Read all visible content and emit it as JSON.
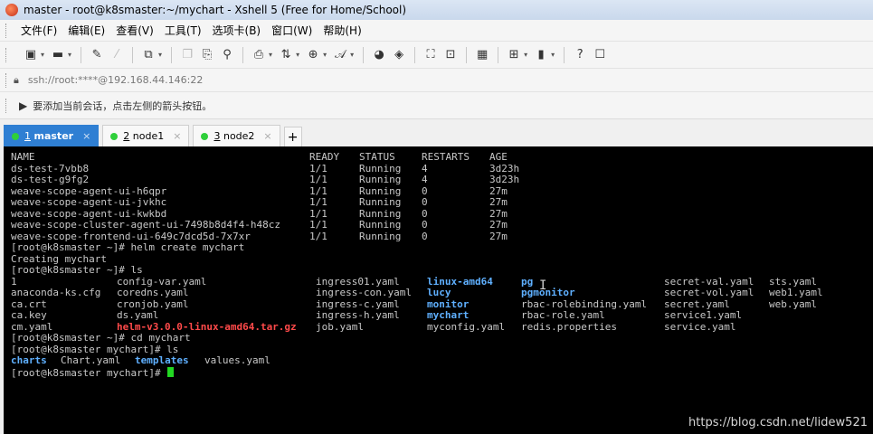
{
  "window": {
    "title": "master - root@k8smaster:~/mychart - Xshell 5 (Free for Home/School)"
  },
  "menu": [
    "文件(F)",
    "编辑(E)",
    "查看(V)",
    "工具(T)",
    "选项卡(B)",
    "窗口(W)",
    "帮助(H)"
  ],
  "toolbar": {
    "icons": [
      "new-session-icon",
      "open-folder-icon",
      "connect-icon",
      "disconnect-icon",
      "new-window-icon",
      "copy-icon",
      "paste-icon",
      "find-icon",
      "print-icon",
      "transfer-icon",
      "globe-icon",
      "font-icon",
      "color-icon",
      "script-icon",
      "fullscreen-icon",
      "lock-icon",
      "keyboard-icon",
      "add-icon",
      "layout-icon",
      "help-icon",
      "chat-icon"
    ]
  },
  "address": {
    "text": "ssh://root:****@192.168.44.146:22"
  },
  "hint": {
    "text": "要添加当前会话，点击左侧的箭头按钮。"
  },
  "tabs": [
    {
      "num": "1",
      "label": "master",
      "active": true
    },
    {
      "num": "2",
      "label": "node1",
      "active": false
    },
    {
      "num": "3",
      "label": "node2",
      "active": false
    }
  ],
  "terminal": {
    "pods": {
      "headers": [
        "NAME",
        "READY",
        "STATUS",
        "RESTARTS",
        "AGE"
      ],
      "rows": [
        [
          "ds-test-7vbb8",
          "1/1",
          "Running",
          "4",
          "3d23h"
        ],
        [
          "ds-test-g9fg2",
          "1/1",
          "Running",
          "4",
          "3d23h"
        ],
        [
          "weave-scope-agent-ui-h6qpr",
          "1/1",
          "Running",
          "0",
          "27m"
        ],
        [
          "weave-scope-agent-ui-jvkhc",
          "1/1",
          "Running",
          "0",
          "27m"
        ],
        [
          "weave-scope-agent-ui-kwkbd",
          "1/1",
          "Running",
          "0",
          "27m"
        ],
        [
          "weave-scope-cluster-agent-ui-7498b8d4f4-h48cz",
          "1/1",
          "Running",
          "0",
          "27m"
        ],
        [
          "weave-scope-frontend-ui-649c7dcd5d-7x7xr",
          "1/1",
          "Running",
          "0",
          "27m"
        ]
      ]
    },
    "lines": {
      "cmd1": "[root@k8smaster ~]# helm create mychart",
      "out1": "Creating mychart",
      "cmd2": "[root@k8smaster ~]# ls",
      "cmd3": "[root@k8smaster ~]# cd mychart",
      "cmd4": "[root@k8smaster mychart]# ls",
      "prompt": "[root@k8smaster mychart]# "
    },
    "ls_root": [
      [
        {
          "t": "1"
        },
        {
          "t": "config-var.yaml"
        },
        {
          "t": "ingress01.yaml"
        },
        {
          "t": "linux-amd64",
          "c": "blue"
        },
        {
          "t": "pg",
          "c": "blue"
        },
        {
          "t": "secret-val.yaml"
        },
        {
          "t": "sts.yaml"
        }
      ],
      [
        {
          "t": "anaconda-ks.cfg"
        },
        {
          "t": "coredns.yaml"
        },
        {
          "t": "ingress-con.yaml"
        },
        {
          "t": "lucy",
          "c": "blue"
        },
        {
          "t": "pgmonitor",
          "c": "blue"
        },
        {
          "t": "secret-vol.yaml"
        },
        {
          "t": "web1.yaml"
        }
      ],
      [
        {
          "t": "ca.crt"
        },
        {
          "t": "cronjob.yaml"
        },
        {
          "t": "ingress-c.yaml"
        },
        {
          "t": "monitor",
          "c": "blue"
        },
        {
          "t": "rbac-rolebinding.yaml"
        },
        {
          "t": "secret.yaml"
        },
        {
          "t": "web.yaml"
        }
      ],
      [
        {
          "t": "ca.key"
        },
        {
          "t": "ds.yaml"
        },
        {
          "t": "ingress-h.yaml"
        },
        {
          "t": "mychart",
          "c": "blue"
        },
        {
          "t": "rbac-role.yaml"
        },
        {
          "t": "service1.yaml"
        },
        {
          "t": ""
        }
      ],
      [
        {
          "t": "cm.yaml"
        },
        {
          "t": "helm-v3.0.0-linux-amd64.tar.gz",
          "c": "red"
        },
        {
          "t": "job.yaml"
        },
        {
          "t": "myconfig.yaml"
        },
        {
          "t": "redis.properties"
        },
        {
          "t": "service.yaml"
        },
        {
          "t": ""
        }
      ]
    ],
    "ls_chart": [
      {
        "t": "charts",
        "c": "blue"
      },
      {
        "t": "Chart.yaml"
      },
      {
        "t": "templates",
        "c": "blue"
      },
      {
        "t": "values.yaml"
      }
    ]
  },
  "watermark": "https://blog.csdn.net/lidew521"
}
